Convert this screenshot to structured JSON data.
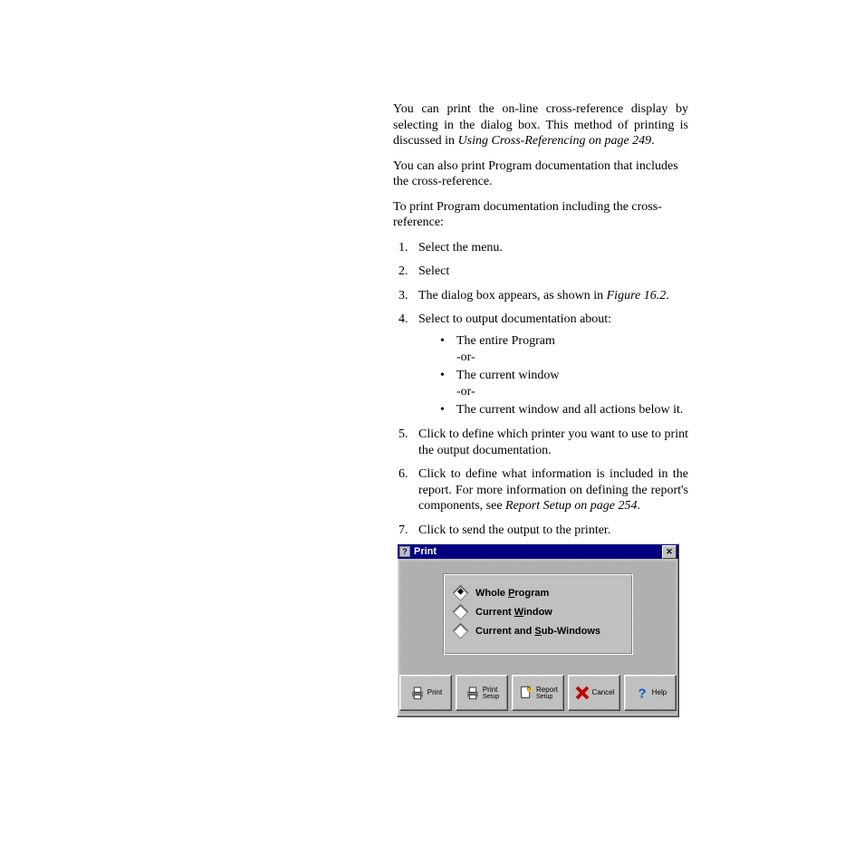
{
  "paragraphs": {
    "p1_a": "You can print the on-line cross-reference display by selecting ",
    "p1_b": " in the ",
    "p1_c": " dialog box. This method of printing is discussed in ",
    "p1_cite": "Using Cross-Referencing on page 249",
    "p1_d": ".",
    "p2": "You can also print Program documentation that includes the cross-reference.",
    "p3": "To print Program documentation including the cross-reference:"
  },
  "steps": {
    "s1_a": "Select the ",
    "s1_b": " menu.",
    "s2": "Select",
    "s3_a": "The ",
    "s3_b": " dialog box appears, as shown in ",
    "s3_cite": "Figure 16.2",
    "s3_c": ".",
    "s4": "Select to output documentation about:",
    "s4_bullets": {
      "b1": "The entire Program\n-or-",
      "b2": "The current window\n-or-",
      "b3": "The current window and all actions below it."
    },
    "s5_a": "Click ",
    "s5_b": " to define which printer you want to use to print the output documentation.",
    "s6_a": "Click ",
    "s6_b": " to define what information is included in the report. For more information on defining the report's components, see ",
    "s6_cite": "Report Setup on page 254",
    "s6_c": ".",
    "s7_a": "Click ",
    "s7_b": " to send the output to the printer."
  },
  "dialog": {
    "title": "Print",
    "options": {
      "whole": "Whole Program",
      "current": "Current Window",
      "sub": "Current and Sub-Windows",
      "whole_accel": "P",
      "current_accel": "W",
      "sub_accel": "S",
      "selected": "whole"
    },
    "buttons": {
      "print": "Print",
      "printsetup_l1": "Print",
      "printsetup_l2": "Setup",
      "reportsetup_l1": "Report",
      "reportsetup_l2": "Setup",
      "cancel": "Cancel",
      "help": "Help"
    }
  }
}
